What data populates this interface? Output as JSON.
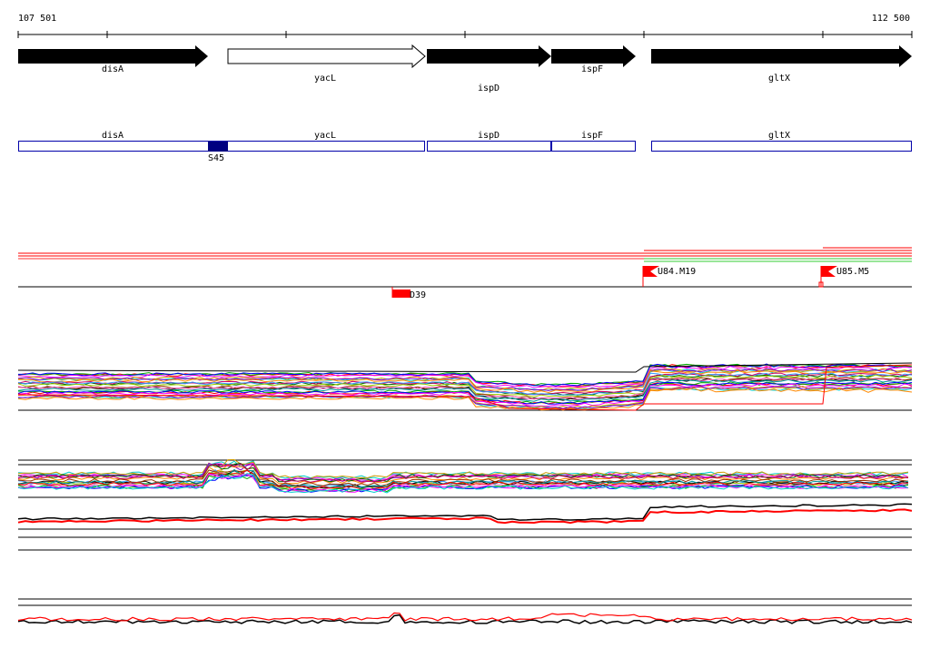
{
  "ruler": {
    "start_label": "107 501",
    "end_label": "112 500"
  },
  "genes": [
    {
      "name": "disA",
      "strand": "forward",
      "style": "filled"
    },
    {
      "name": "yacL",
      "strand": "forward",
      "style": "outline"
    },
    {
      "name": "ispD",
      "strand": "forward",
      "style": "filled"
    },
    {
      "name": "ispF",
      "strand": "forward",
      "style": "filled"
    },
    {
      "name": "gltX",
      "strand": "forward",
      "style": "filled"
    }
  ],
  "gene_boxes": [
    "disA",
    "yacL",
    "ispD",
    "ispF",
    "gltX"
  ],
  "marker_box": {
    "label": "S45"
  },
  "flags": [
    {
      "label": "U84.M19"
    },
    {
      "label": "U85.M5"
    }
  ],
  "red_marker": {
    "label": "D39"
  },
  "colors": {
    "gene_fill": "#000000",
    "box_stroke": "#0000aa",
    "marker_fill": "#000080",
    "flag": "#ff0000",
    "green_line": "#33cc33"
  }
}
